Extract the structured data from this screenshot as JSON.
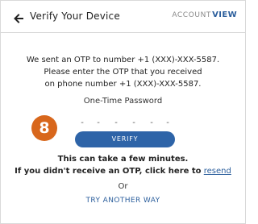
{
  "header": {
    "title": "Verify Your Device",
    "account_label": "ACCOUNT",
    "view_label": "VIEW"
  },
  "message": {
    "line1": "We sent an OTP to number +1 (XXX)-XXX-5587.",
    "line2": "Please enter the OTP that you received",
    "line3": "on phone number +1 (XXX)-XXX-5587."
  },
  "otp": {
    "label": "One-Time Password",
    "digit_placeholder": "-",
    "digits": [
      "-",
      "-",
      "-",
      "-",
      "-",
      "-"
    ]
  },
  "step_badge": "8",
  "verify_button": "VERIFY",
  "notes": {
    "wait": "This can take a few minutes.",
    "prefix": "If you didn't receive an OTP, click here to",
    "resend_link": "resend"
  },
  "or_label": "Or",
  "try_another_way": "TRY ANOTHER WAY",
  "colors": {
    "accent": "#2e64a8",
    "badge": "#d8671c"
  },
  "icons": {
    "back": "arrow-left-icon"
  }
}
